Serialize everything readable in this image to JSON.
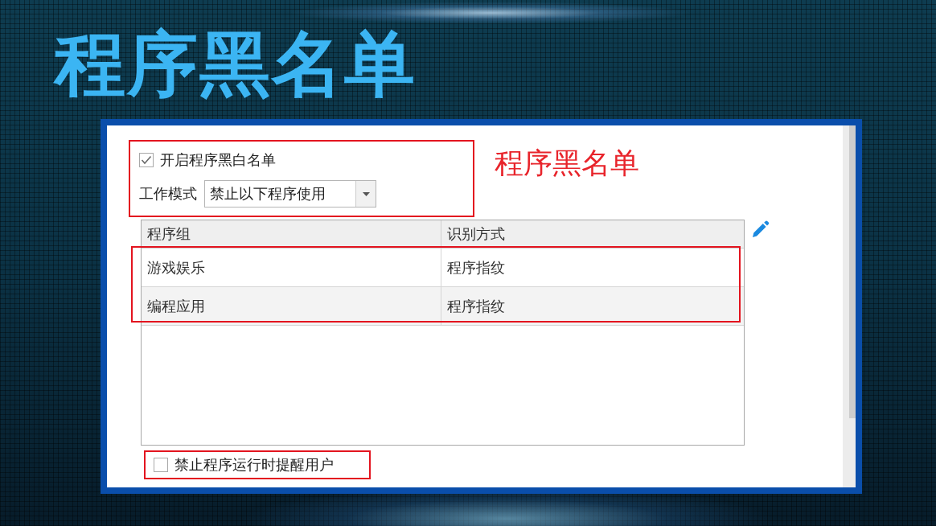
{
  "slide": {
    "title": "程序黑名单",
    "annotation": "程序黑名单"
  },
  "panel": {
    "blacklist_toggle": {
      "label": "开启程序黑白名单",
      "checked": true
    },
    "work_mode": {
      "label": "工作模式",
      "value": "禁止以下程序使用"
    },
    "table": {
      "columns": [
        "程序组",
        "识别方式"
      ],
      "rows": [
        {
          "cells": [
            "游戏娱乐",
            "程序指纹"
          ],
          "selected": false
        },
        {
          "cells": [
            "编程应用",
            "程序指纹"
          ],
          "selected": true
        }
      ]
    },
    "remind_user": {
      "label": "禁止程序运行时提醒用户",
      "checked": false
    }
  }
}
